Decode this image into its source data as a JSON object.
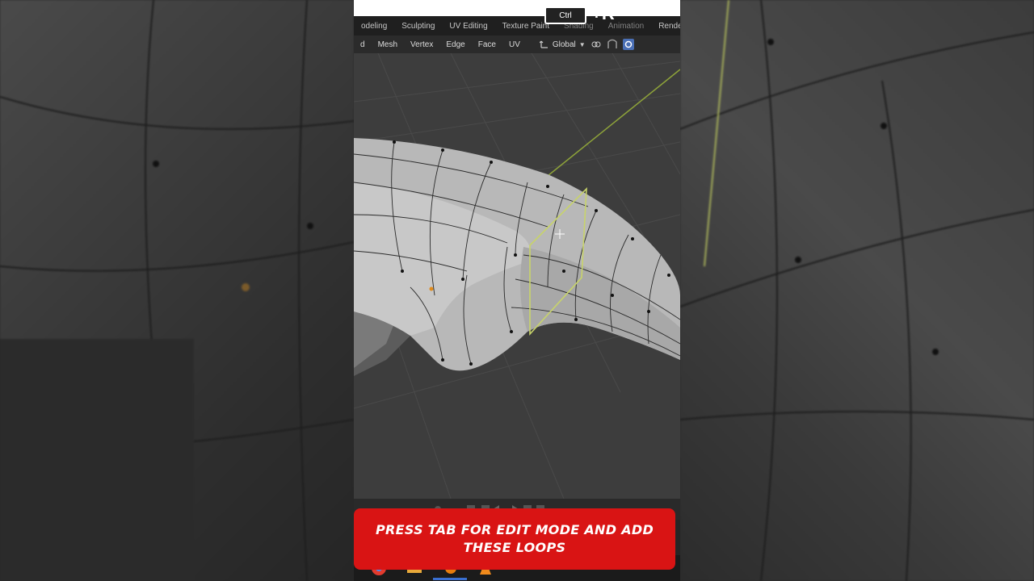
{
  "shortcut": {
    "key": "Ctrl",
    "plus": "+R"
  },
  "workspace_tabs": [
    {
      "label": "odeling",
      "dim": false
    },
    {
      "label": "Sculpting",
      "dim": false
    },
    {
      "label": "UV Editing",
      "dim": false
    },
    {
      "label": "Texture Paint",
      "dim": false
    },
    {
      "label": "Shading",
      "dim": true
    },
    {
      "label": "Animation",
      "dim": true
    },
    {
      "label": "Rendering",
      "dim": false
    }
  ],
  "menu": {
    "items": [
      "d",
      "Mesh",
      "Vertex",
      "Edge",
      "Face",
      "UV"
    ],
    "orientation": "Global"
  },
  "caption": "PRESS TAB FOR EDIT MODE AND ADD THESE LOOPS",
  "colors": {
    "caption_bg": "#d91414",
    "loop_highlight": "#c8d46a"
  },
  "icons": [
    "move-icon",
    "link-icon",
    "snap-icon",
    "proportional-icon",
    "chrome-icon",
    "folder-icon",
    "blender-icon",
    "vlc-icon"
  ]
}
